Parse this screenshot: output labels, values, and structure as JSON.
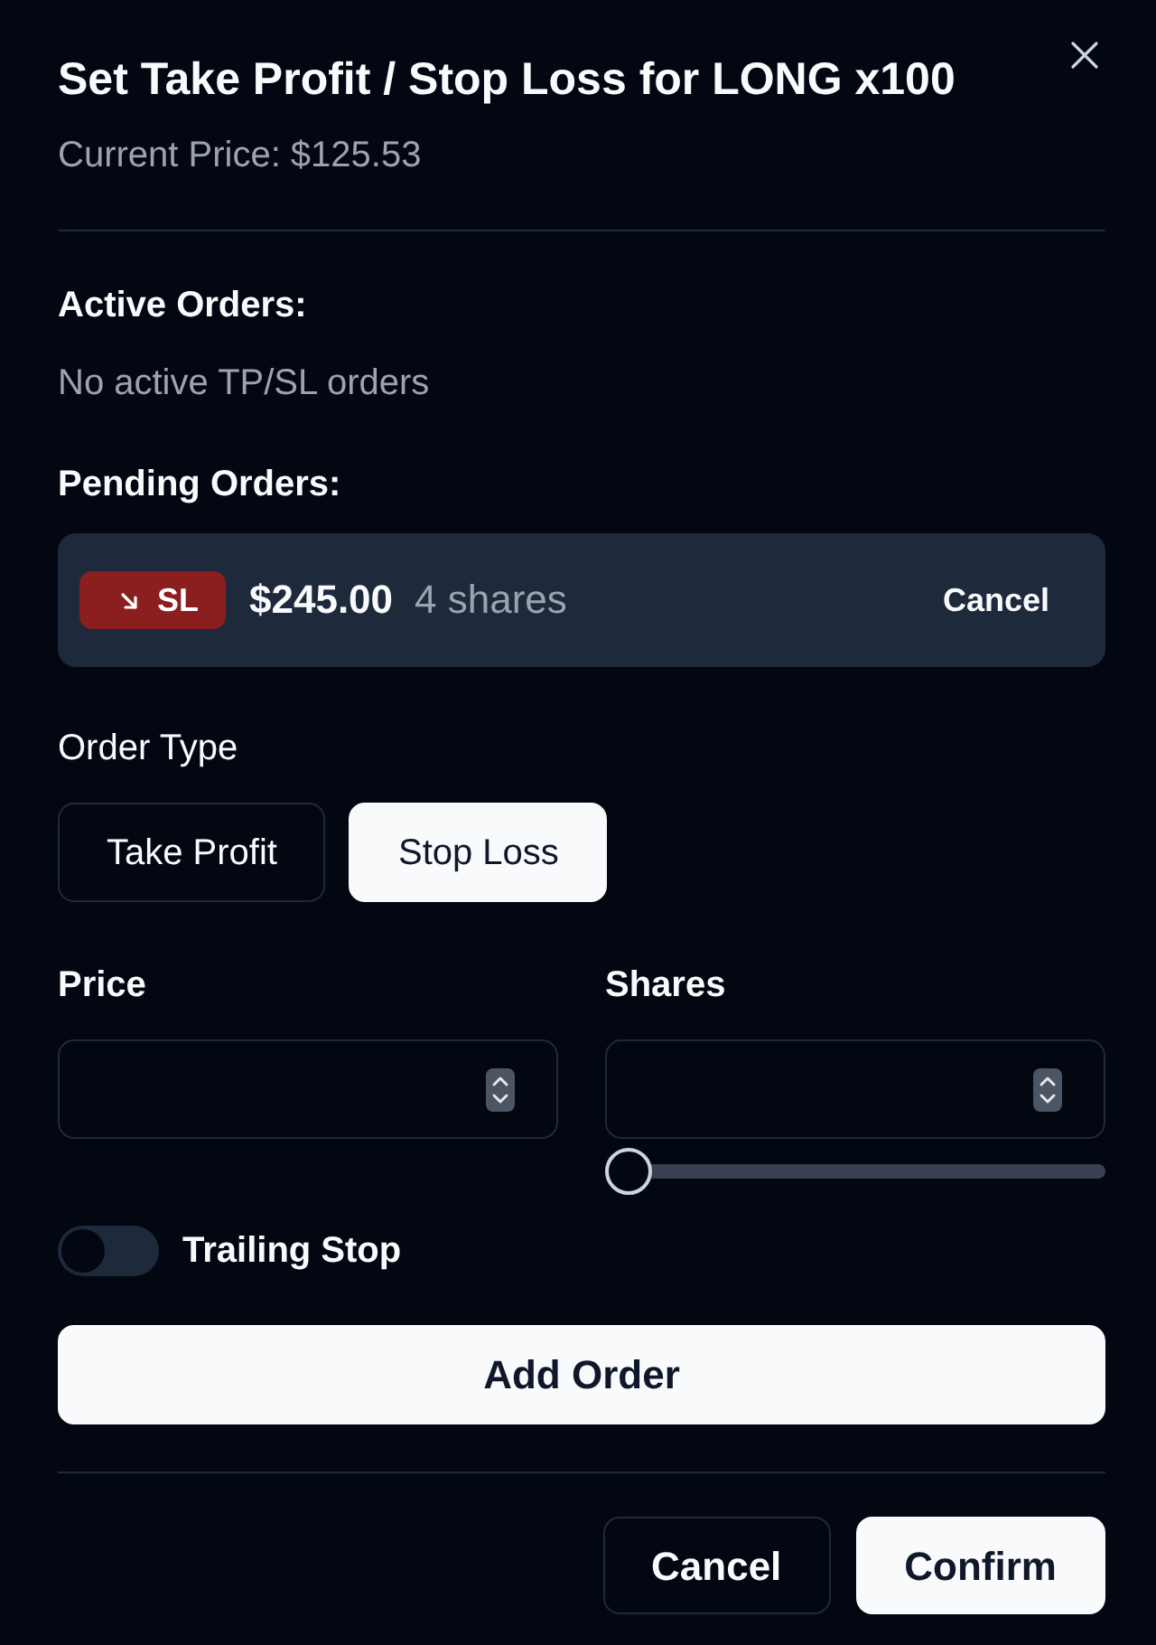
{
  "dialog": {
    "title": "Set Take Profit / Stop Loss for LONG x100",
    "subtitle": "Current Price: $125.53"
  },
  "active_orders": {
    "heading": "Active Orders:",
    "empty_text": "No active TP/SL orders"
  },
  "pending_orders": {
    "heading": "Pending Orders:",
    "items": [
      {
        "kind": "stop_loss",
        "tag": "SL",
        "price": "$245.00",
        "shares": "4 shares",
        "action": "Cancel"
      }
    ]
  },
  "order_type": {
    "label": "Order Type",
    "options": [
      {
        "label": "Take Profit",
        "selected": false
      },
      {
        "label": "Stop Loss",
        "selected": true
      }
    ]
  },
  "price": {
    "label": "Price"
  },
  "shares": {
    "label": "Shares",
    "level": 0
  },
  "trailing_stop": {
    "label": "Trailing Stop",
    "on": false
  },
  "add_button": "Add Order",
  "footer": {
    "buttons": [
      {
        "label": "Cancel",
        "kind": "secondary"
      },
      {
        "label": "Confirm",
        "kind": "primary"
      }
    ]
  }
}
